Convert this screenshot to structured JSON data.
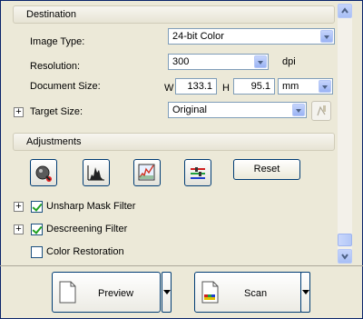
{
  "destination": {
    "header": "Destination",
    "image_type_label": "Image Type:",
    "image_type_value": "24-bit Color",
    "resolution_label": "Resolution:",
    "resolution_value": "300",
    "resolution_unit": "dpi",
    "document_size_label": "Document Size:",
    "width_label": "W",
    "width_value": "133.1",
    "height_label": "H",
    "height_value": "95.1",
    "size_unit": "mm",
    "target_size_label": "Target Size:",
    "target_size_value": "Original",
    "expand_symbol": "+"
  },
  "adjustments": {
    "header": "Adjustments",
    "buttons": [
      {
        "icon": "auto-exposure-icon"
      },
      {
        "icon": "histogram-icon"
      },
      {
        "icon": "tone-correction-icon"
      },
      {
        "icon": "color-palette-icon"
      }
    ],
    "reset_label": "Reset",
    "options": [
      {
        "label": "Unsharp Mask Filter",
        "checked": true,
        "expandable": true
      },
      {
        "label": "Descreening Filter",
        "checked": true,
        "expandable": true
      },
      {
        "label": "Color Restoration",
        "checked": false,
        "expandable": false
      }
    ]
  },
  "footer": {
    "preview_label": "Preview",
    "scan_label": "Scan"
  }
}
